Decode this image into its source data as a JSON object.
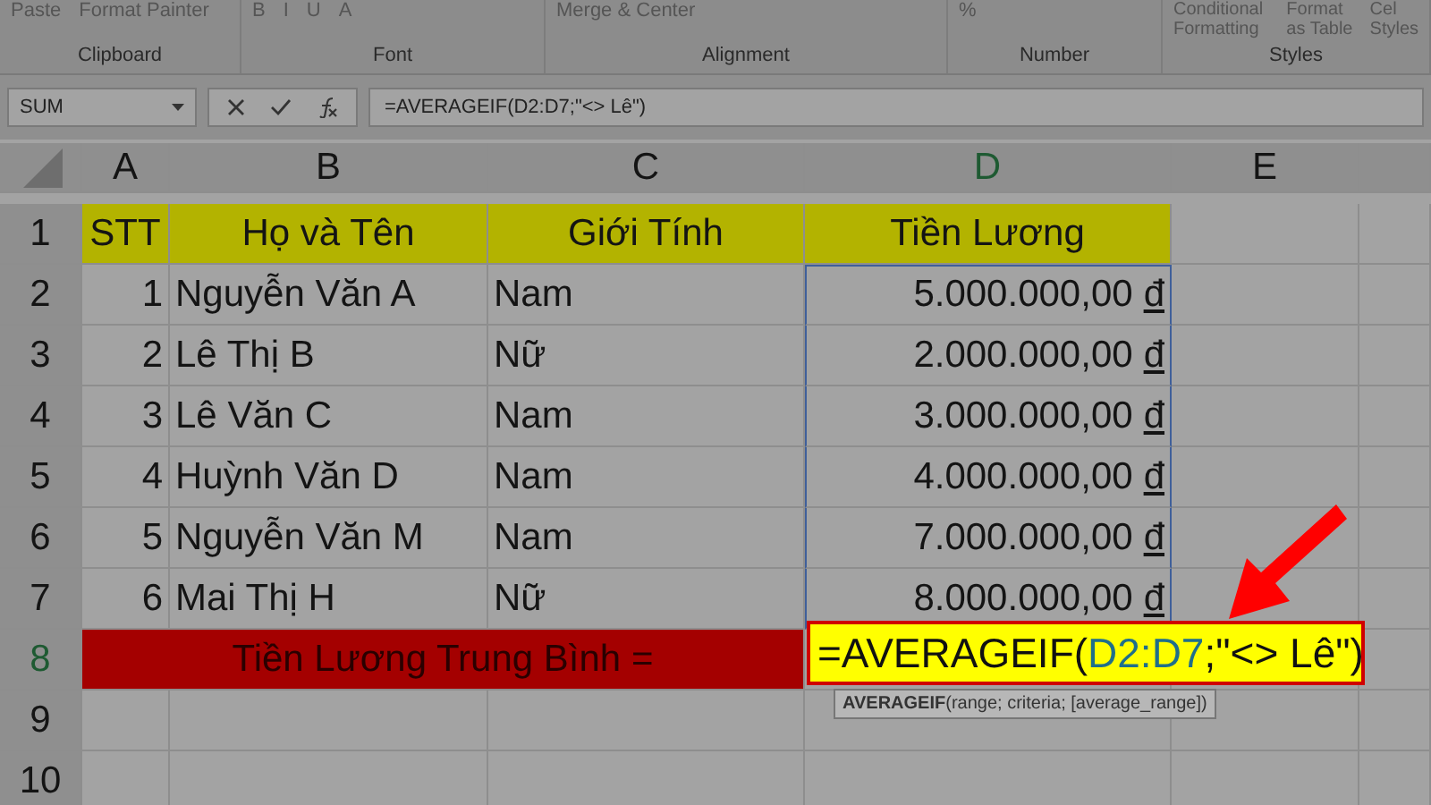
{
  "ribbon": {
    "groups": [
      {
        "label": "Clipboard",
        "items": [
          "Paste",
          "Format Painter"
        ]
      },
      {
        "label": "Font",
        "items": [
          "B",
          "I",
          "U",
          "A"
        ]
      },
      {
        "label": "Alignment",
        "items": [
          "Merge & Center"
        ]
      },
      {
        "label": "Number",
        "items": [
          "%"
        ]
      },
      {
        "label": "Styles",
        "items": [
          "Conditional Formatting",
          "Format as Table",
          "Cel Styles"
        ]
      }
    ]
  },
  "formula_bar": {
    "name_box": "SUM",
    "formula": "=AVERAGEIF(D2:D7;\"<> Lê\")"
  },
  "columns": [
    {
      "label": "A",
      "selected": false
    },
    {
      "label": "B",
      "selected": false
    },
    {
      "label": "C",
      "selected": false
    },
    {
      "label": "D",
      "selected": true
    },
    {
      "label": "E",
      "selected": false
    }
  ],
  "rows": [
    {
      "number": "1",
      "kind": "header",
      "selected": false,
      "cells": [
        "STT",
        "Họ và Tên",
        "Giới Tính",
        "Tiền Lương"
      ]
    },
    {
      "number": "2",
      "kind": "data",
      "selected": false,
      "stt": "1",
      "name": "Nguyễn Văn A",
      "gender": "Nam",
      "salary": "5.000.000,00",
      "currency": "đ"
    },
    {
      "number": "3",
      "kind": "data",
      "selected": false,
      "stt": "2",
      "name": "Lê Thị B",
      "gender": "Nữ",
      "salary": "2.000.000,00",
      "currency": "đ"
    },
    {
      "number": "4",
      "kind": "data",
      "selected": false,
      "stt": "3",
      "name": "Lê Văn C",
      "gender": "Nam",
      "salary": "3.000.000,00",
      "currency": "đ"
    },
    {
      "number": "5",
      "kind": "data",
      "selected": false,
      "stt": "4",
      "name": "Huỳnh Văn D",
      "gender": "Nam",
      "salary": "4.000.000,00",
      "currency": "đ"
    },
    {
      "number": "6",
      "kind": "data",
      "selected": false,
      "stt": "5",
      "name": "Nguyễn Văn M",
      "gender": "Nam",
      "salary": "7.000.000,00",
      "currency": "đ"
    },
    {
      "number": "7",
      "kind": "data",
      "selected": false,
      "stt": "6",
      "name": "Mai Thị H",
      "gender": "Nữ",
      "salary": "8.000.000,00",
      "currency": "đ"
    },
    {
      "number": "8",
      "kind": "summary",
      "selected": true,
      "label": "Tiền Lương Trung Bình =",
      "formula_parts": [
        {
          "text": "=AVERAGEIF(",
          "ref": false
        },
        {
          "text": "D2:D7",
          "ref": true
        },
        {
          "text": ";\"<> Lê\")",
          "ref": false
        }
      ],
      "tooltip": "**AVERAGEIF**(range; criteria; [average_range])"
    },
    {
      "number": "9",
      "kind": "empty",
      "selected": false
    },
    {
      "number": "10",
      "kind": "empty",
      "selected": false
    }
  ]
}
